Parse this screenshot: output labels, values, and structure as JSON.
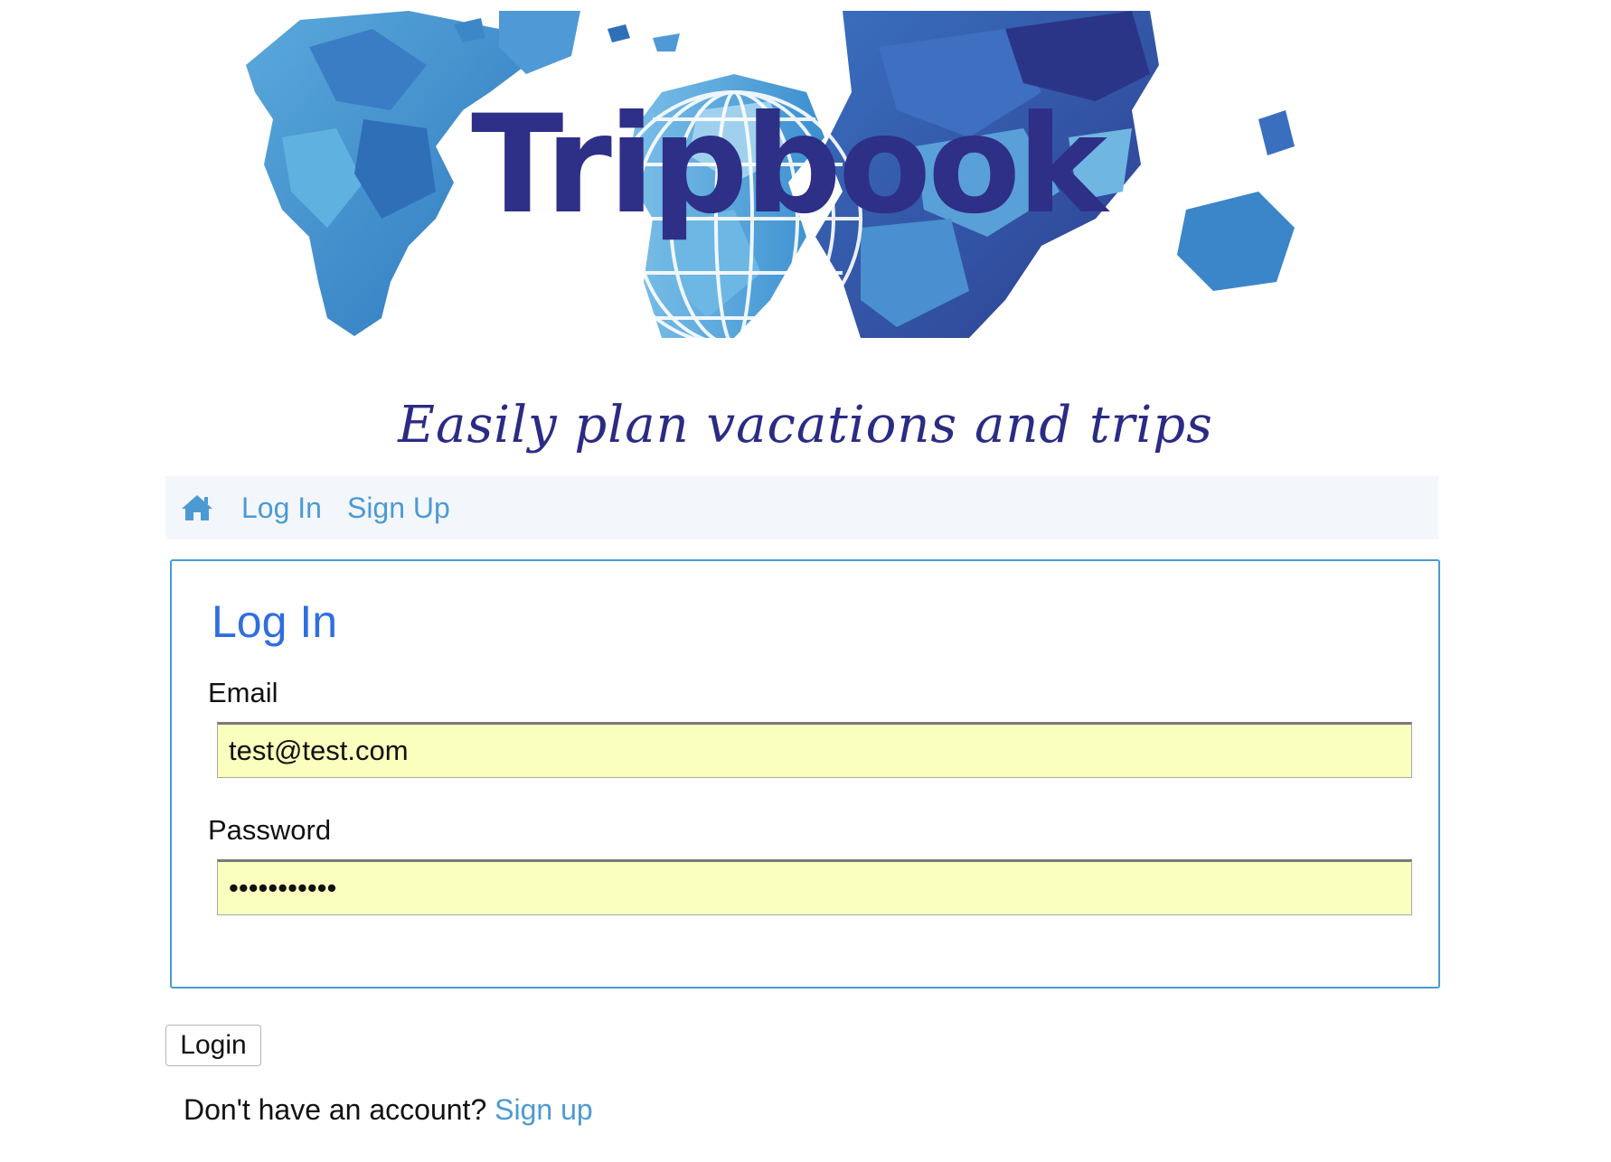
{
  "banner": {
    "logo_text": "Tripbook",
    "tagline": "Easily plan vacations and trips"
  },
  "navbar": {
    "home_icon": "home-icon",
    "links": [
      "Log In",
      "Sign Up"
    ]
  },
  "login_form": {
    "title": "Log In",
    "email_label": "Email",
    "email_value": "test@test.com",
    "password_label": "Password",
    "password_value": "•••••••••••",
    "submit_label": "Login"
  },
  "footer": {
    "prompt_text": "Don't have an account?",
    "signup_link": "Sign up"
  },
  "colors": {
    "brand_navy": "#2e2f86",
    "link_blue": "#4c9ad3",
    "title_blue": "#2f6ee0",
    "autofill_yellow": "#faffbd",
    "navbar_bg": "#f3f7fc"
  }
}
